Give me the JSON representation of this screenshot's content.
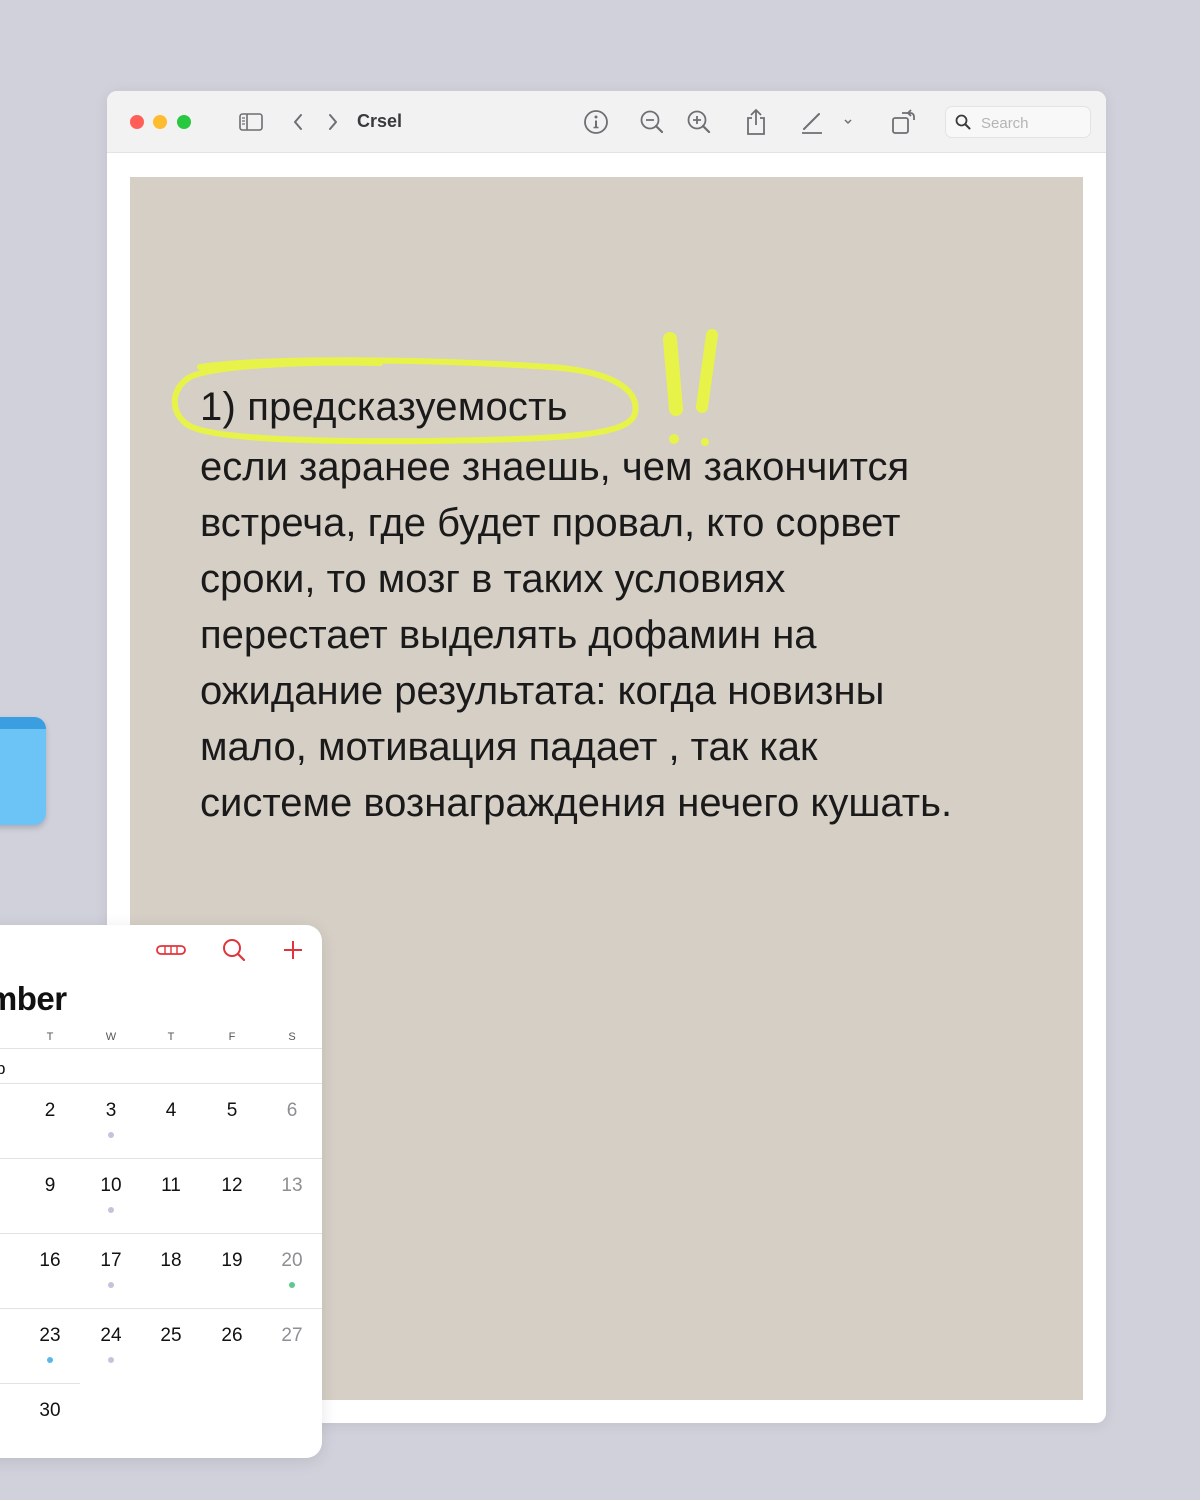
{
  "window": {
    "title": "Crsel",
    "search_placeholder": "Search",
    "traffic_lights": {
      "close": "#ff5f57",
      "minimize": "#febc2e",
      "zoom": "#28c840"
    },
    "toolbar_icons": [
      "sidebar-icon",
      "back-chevron-icon",
      "forward-chevron-icon",
      "info-icon",
      "zoom-out-icon",
      "zoom-in-icon",
      "share-icon",
      "markup-pen-icon",
      "chevron-down-icon",
      "rotate-icon",
      "search-icon"
    ]
  },
  "page": {
    "background": "#d6cfc6",
    "highlight_color": "#e8f34a",
    "heading": "1) предсказуемость",
    "body_lines": [
      "если заранее знаешь, чем закончится",
      "встреча, где будет провал, кто сорвет",
      "сроки, то мозг в таких условиях",
      "перестает выделять дофамин на",
      "ожидание результата: когда новизны",
      "мало, мотивация падает , так как",
      "системе вознаграждения нечего кушать."
    ]
  },
  "calendar": {
    "accent": "#e0343a",
    "month_fragment": "ember",
    "prev_fragment": "p",
    "weekday_headers": [
      "T",
      "W",
      "T",
      "F",
      "S"
    ],
    "weeks": [
      {
        "days": [
          "2",
          "3",
          "4",
          "5",
          "6"
        ],
        "dots": [
          null,
          "#c5c3dc",
          null,
          null,
          null
        ]
      },
      {
        "days": [
          "9",
          "10",
          "11",
          "12",
          "13"
        ],
        "dots": [
          null,
          "#c5c3dc",
          null,
          null,
          null
        ]
      },
      {
        "days": [
          "16",
          "17",
          "18",
          "19",
          "20"
        ],
        "dots": [
          null,
          "#c5c3dc",
          null,
          null,
          "#5cc98f"
        ]
      },
      {
        "days": [
          "23",
          "24",
          "25",
          "26",
          "27"
        ],
        "dots": [
          "#5ab8e8",
          "#c5c3dc",
          null,
          null,
          null
        ]
      },
      {
        "days": [
          "30"
        ],
        "dots": [
          null
        ]
      }
    ],
    "icons": [
      "calendars-pill-icon",
      "search-icon",
      "plus-icon"
    ]
  }
}
